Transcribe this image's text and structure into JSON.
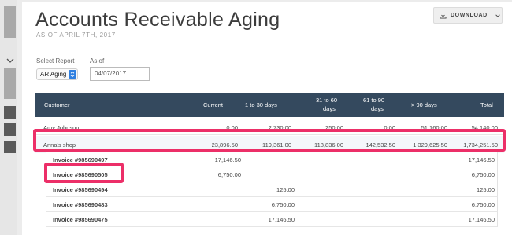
{
  "colors": {
    "accent": "#ec2f68",
    "invoice_link": "#2e9a5e",
    "header_bg": "#34495e",
    "select_spinner": "#2f7fe0"
  },
  "page": {
    "title": "Accounts Receivable Aging",
    "subtitle": "AS OF APRIL 7TH, 2017",
    "download_label": "DOWNLOAD",
    "download_icon": "download-icon",
    "chevron_icon": "chevron-down-icon"
  },
  "filters": {
    "select_report_label": "Select Report",
    "select_report_value": "AR Aging",
    "as_of_label": "As of",
    "as_of_value": "04/07/2017"
  },
  "table": {
    "headers": {
      "customer": "Customer",
      "current": "Current",
      "d1_30": "1 to 30 days",
      "d31_60_a": "31 to 60",
      "d31_60_b": "days",
      "d61_90_a": "61 to 90",
      "d61_90_b": "days",
      "d90": "> 90 days",
      "total": "Total"
    },
    "customers": [
      {
        "name": "Amy Johnson",
        "current": "0.00",
        "d1_30": "2,730.00",
        "d31_60": "250.00",
        "d61_90": "0.00",
        "d90": "51,160.00",
        "total": "54,140.00"
      },
      {
        "name": "Anna's shop",
        "current": "23,896.50",
        "d1_30": "119,361.00",
        "d31_60": "118,836.00",
        "d61_90": "142,532.50",
        "d90": "1,329,625.50",
        "total": "1,734,251.50"
      }
    ],
    "invoices": [
      {
        "label": "Invoice #985690497",
        "current": "17,146.50",
        "d1_30": "",
        "total": "17,146.50"
      },
      {
        "label": "Invoice #985690505",
        "current": "6,750.00",
        "d1_30": "",
        "total": "6,750.00"
      },
      {
        "label": "Invoice #985690494",
        "current": "",
        "d1_30": "125.00",
        "total": "125.00"
      },
      {
        "label": "Invoice #985690483",
        "current": "",
        "d1_30": "6,750.00",
        "total": "6,750.00"
      },
      {
        "label": "Invoice #985690475",
        "current": "",
        "d1_30": "17,146.50",
        "total": "17,146.50"
      }
    ]
  }
}
